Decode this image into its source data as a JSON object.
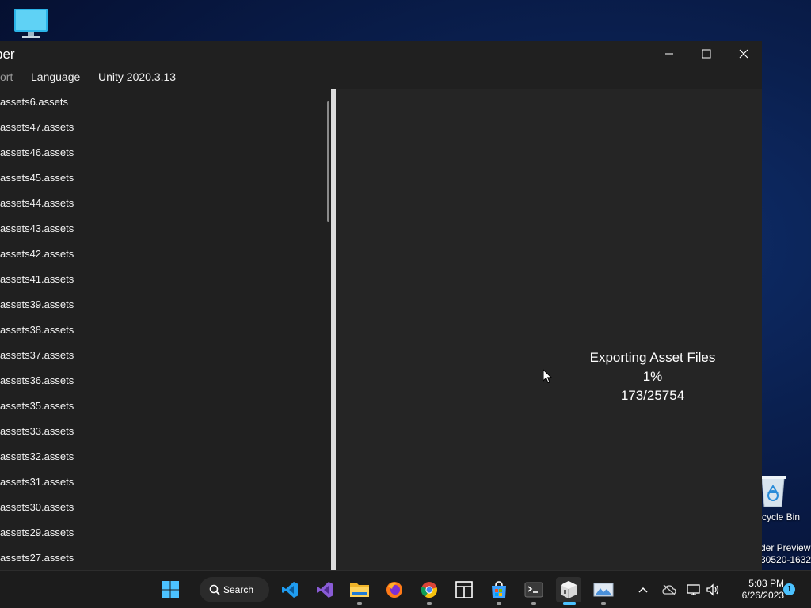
{
  "desktop": {
    "recycle_bin_label": "cycle Bin",
    "watermark_line1": "der Preview",
    "watermark_line2": "30520-1632"
  },
  "window": {
    "title": "per",
    "menu": {
      "clipped_item": "ort",
      "language": "Language",
      "unity_version": "Unity 2020.3.13"
    },
    "files": [
      "assets6.assets",
      "assets47.assets",
      "assets46.assets",
      "assets45.assets",
      "assets44.assets",
      "assets43.assets",
      "assets42.assets",
      "assets41.assets",
      "assets39.assets",
      "assets38.assets",
      "assets37.assets",
      "assets36.assets",
      "assets35.assets",
      "assets33.assets",
      "assets32.assets",
      "assets31.assets",
      "assets30.assets",
      "assets29.assets",
      "assets27.assets"
    ],
    "progress": {
      "status": "Exporting Asset Files",
      "percent": "1%",
      "count": "173/25754"
    }
  },
  "taskbar": {
    "search_label": "Search",
    "clock_time": "5:03 PM",
    "clock_date": "6/26/2023",
    "notification_count": "1",
    "apps": [
      "windows-start-icon",
      "vscode-icon",
      "visual-studio-icon",
      "file-explorer-icon",
      "firefox-icon",
      "chrome-icon",
      "snap-layout-icon",
      "microsoft-store-icon",
      "terminal-icon",
      "asset-studio-icon",
      "photo-viewer-icon"
    ]
  },
  "colors": {
    "accent": "#4cc2ff",
    "window_bg": "#202020",
    "preview_bg": "#252525",
    "taskbar_bg": "#1c1c1c"
  }
}
